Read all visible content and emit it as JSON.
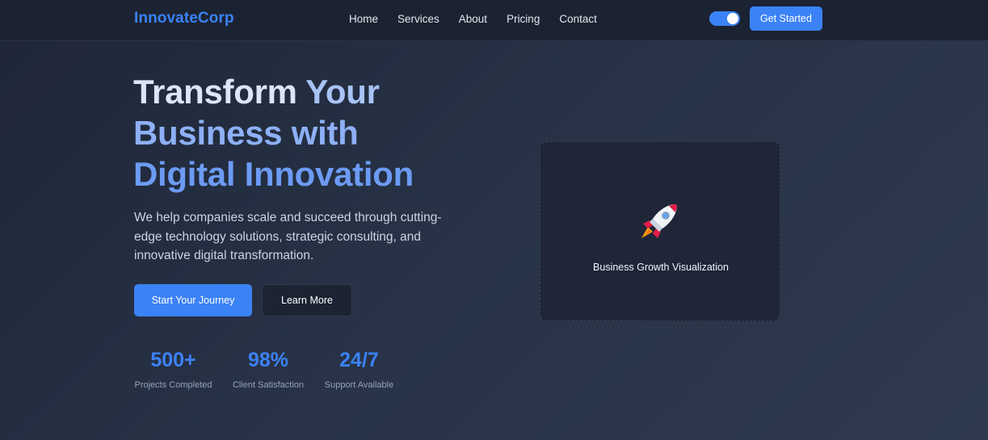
{
  "brand": {
    "name": "InnovateCorp",
    "accent": "#3b82f6"
  },
  "nav": {
    "links": [
      "Home",
      "Services",
      "About",
      "Pricing",
      "Contact"
    ],
    "theme_toggle_on": true,
    "cta_label": "Get Started"
  },
  "hero": {
    "title_line1_part1": "Transform ",
    "title_line1_part2": "Your",
    "title_line2": "Business with",
    "title_line3": "Digital Innovation",
    "description": "We help companies scale and succeed through cutting-edge technology solutions, strategic consulting, and innovative digital transformation.",
    "primary_button": "Start Your Journey",
    "secondary_button": "Learn More"
  },
  "stats": [
    {
      "value": "500+",
      "label": "Projects Completed"
    },
    {
      "value": "98%",
      "label": "Client Satisfaction"
    },
    {
      "value": "24/7",
      "label": "Support Available"
    }
  ],
  "visual": {
    "icon": "rocket-icon",
    "caption": "Business Growth Visualization"
  }
}
